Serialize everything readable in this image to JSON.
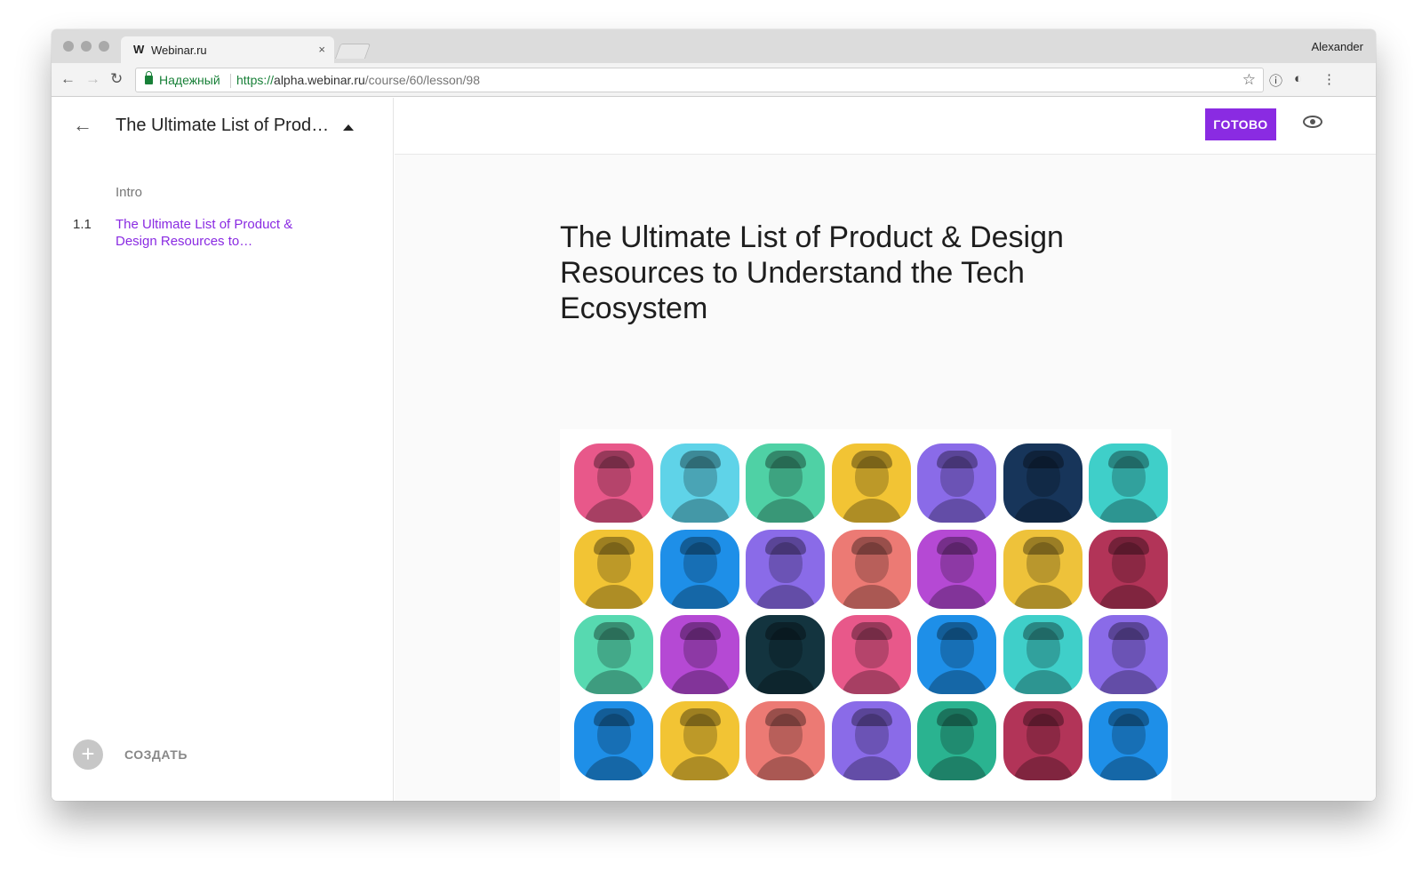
{
  "browser": {
    "tab_title": "Webinar.ru",
    "tab_favicon": "W",
    "tab_close": "×",
    "profile_name": "Alexander",
    "secure_label": "Надежный",
    "url_scheme": "https://",
    "url_host": "alpha.webinar.ru",
    "url_path": "/course/60/lesson/98"
  },
  "sidebar": {
    "course_title": "The Ultimate List of Prod…",
    "section": "Intro",
    "lesson_number": "1.1",
    "lesson_title": "The Ultimate List of Product & Design Resources to…",
    "create_label": "СОЗДАТЬ"
  },
  "main": {
    "done_label": "ГОТОВО",
    "article_title": "The Ultimate List of Product & Design Resources to Understand the Tech Ecosystem"
  },
  "hero": {
    "avatar_colors": [
      "#e8588a",
      "#5fd3e8",
      "#4fd1a5",
      "#f2c434",
      "#8a6be8",
      "#17355a",
      "#3fcfc9",
      "#f2c434",
      "#1e8fe8",
      "#8a6be8",
      "#ec7a74",
      "#b549d4",
      "#eec23a",
      "#b23458",
      "#57d9b0",
      "#b549d4",
      "#13343f",
      "#e8588a",
      "#1e8fe8",
      "#3fcfc9",
      "#8a6be8",
      "#1e8fe8",
      "#f2c434",
      "#ec7a74",
      "#8a6be8",
      "#2ab390",
      "#b23458",
      "#1e8fe8"
    ]
  },
  "icons": {
    "back": "arrow-left-icon",
    "forward": "arrow-right-icon",
    "reload": "reload-icon",
    "lock": "lock-icon",
    "star": "star-icon",
    "eye": "eye-icon",
    "plus": "plus-icon",
    "caret": "caret-up-icon"
  }
}
